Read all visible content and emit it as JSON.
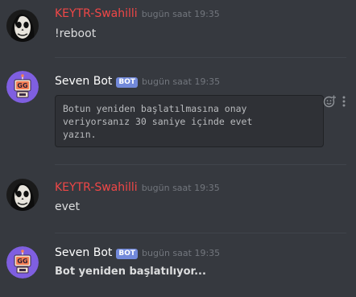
{
  "messages": [
    {
      "author": "KEYTR-Swahilli",
      "author_color": "#f04747",
      "timestamp": "bugün saat 19:35",
      "text": "!reboot"
    },
    {
      "author": "Seven Bot",
      "author_color": "#ffffff",
      "bot_tag": "BOT",
      "timestamp": "bugün saat 19:35",
      "code_lines": [
        "Botun yeniden başlatılmasına onay",
        "veriyorsanız 30 saniye içinde evet",
        "yazın."
      ]
    },
    {
      "author": "KEYTR-Swahilli",
      "author_color": "#f04747",
      "timestamp": "bugün saat 19:35",
      "text": "evet"
    },
    {
      "author": "Seven Bot",
      "author_color": "#ffffff",
      "bot_tag": "BOT",
      "timestamp": "bugün saat 19:35",
      "text": "Bot yeniden başlatılıyor..."
    }
  ],
  "avatars": {
    "user_icon": "skull-face-icon",
    "bot_icon": "gg-robot-icon",
    "bot_avatar_bg": "#7f5fe0"
  },
  "icons": {
    "reaction": "add-reaction-icon",
    "more": "more-options-icon"
  }
}
